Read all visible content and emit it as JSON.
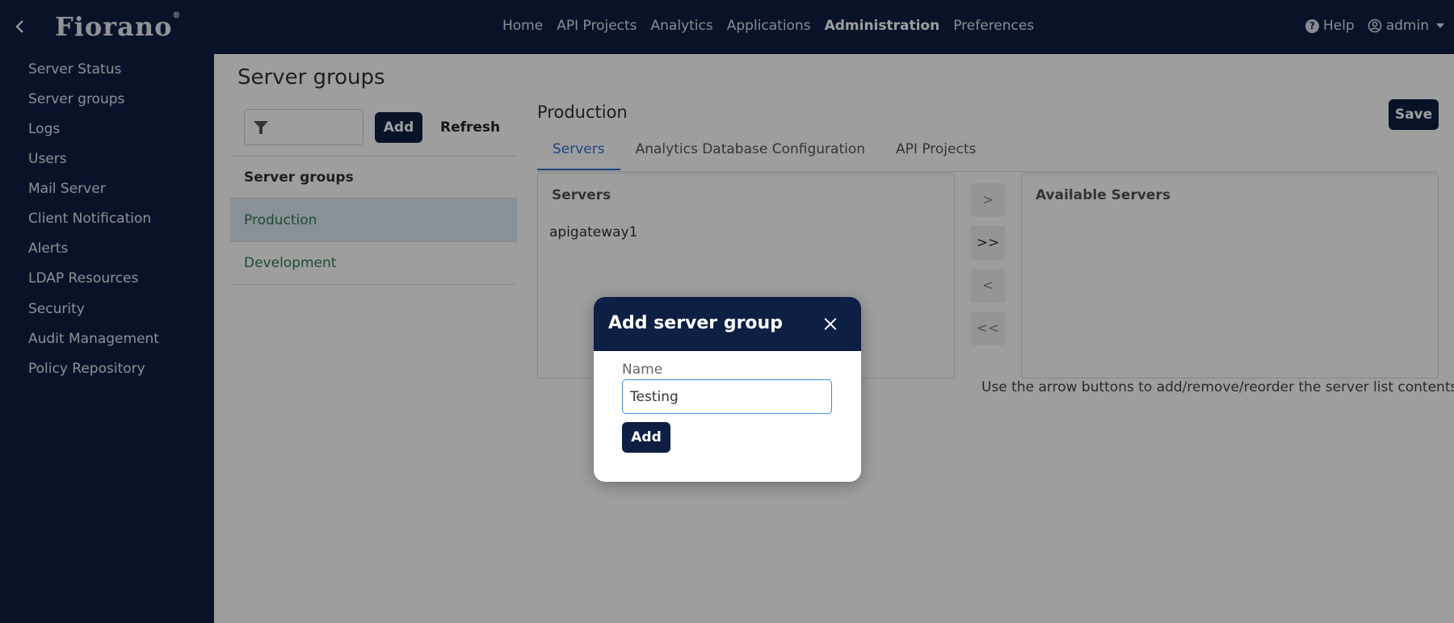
{
  "topbar": {
    "logo": "Fiorano",
    "logo_mark": "®",
    "nav": [
      "Home",
      "API Projects",
      "Analytics",
      "Applications",
      "Administration",
      "Preferences"
    ],
    "active_nav": "Administration",
    "help_label": "Help",
    "user_label": "admin"
  },
  "sidebar": {
    "items": [
      "Server Status",
      "Server groups",
      "Logs",
      "Users",
      "Mail Server",
      "Client Notification",
      "Alerts",
      "LDAP Resources",
      "Security",
      "Audit Management",
      "Policy Repository"
    ]
  },
  "main": {
    "title": "Server groups",
    "filter_placeholder": "",
    "add_label": "Add",
    "refresh_label": "Refresh",
    "list_header": "Server groups",
    "groups": [
      "Production",
      "Development"
    ],
    "selected_group": "Production"
  },
  "detail": {
    "title": "Production",
    "save_label": "Save",
    "tabs": [
      "Servers",
      "Analytics Database Configuration",
      "API Projects"
    ],
    "active_tab": "Servers",
    "servers_title": "Servers",
    "servers": [
      "apigateway1"
    ],
    "available_title": "Available Servers",
    "arrows": [
      ">",
      ">>",
      "<",
      "<<"
    ],
    "hint": "Use the arrow buttons to add/remove/reorder the server list contents"
  },
  "modal": {
    "title": "Add server group",
    "name_label": "Name",
    "name_value": "Testing",
    "add_label": "Add"
  },
  "colors": {
    "navy": "#0e1f44",
    "accent_blue": "#2f6fd1",
    "group_green": "#2e7d4f",
    "selected_row": "#dfe9f6"
  }
}
